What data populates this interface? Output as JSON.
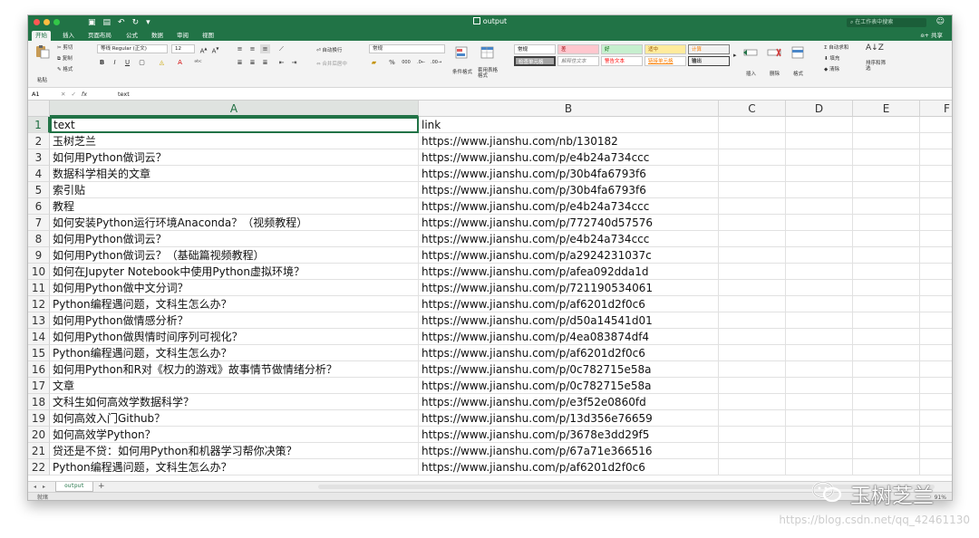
{
  "window": {
    "title": "output",
    "search_placeholder": "在工作表中搜索",
    "colors": {
      "accent": "#217346",
      "close": "#fc5753",
      "minimize": "#fdbc40",
      "zoom": "#33c748"
    }
  },
  "ribbon_tabs": [
    "开始",
    "插入",
    "页面布局",
    "公式",
    "数据",
    "审阅",
    "视图"
  ],
  "share_label": "共享",
  "ribbon": {
    "paste": "粘贴",
    "cut": "剪切",
    "copy": "复制",
    "format_painter": "格式",
    "font_name": "等线 Regular (正文)",
    "font_size": "12",
    "wrap_text": "自动换行",
    "merge_center": "合并后居中",
    "number_format": "常规",
    "percent": "%",
    "thousands": "000",
    "conditional_format": "条件格式",
    "format_as_table": "套用表格格式",
    "styles": [
      {
        "label": "常规",
        "bg": "#ffffff",
        "fg": "#000000"
      },
      {
        "label": "差",
        "bg": "#ffc7ce",
        "fg": "#9c0006"
      },
      {
        "label": "好",
        "bg": "#c6efce",
        "fg": "#006100"
      },
      {
        "label": "适中",
        "bg": "#ffeb9c",
        "fg": "#9c5700"
      },
      {
        "label": "计算",
        "bg": "#f2f2f2",
        "fg": "#fa7d00"
      },
      {
        "label": "检查单元格",
        "bg": "#a5a5a5",
        "fg": "#ffffff"
      },
      {
        "label": "解释性文本",
        "bg": "#ffffff",
        "fg": "#7f7f7f"
      },
      {
        "label": "警告文本",
        "bg": "#ffffff",
        "fg": "#ff0000"
      },
      {
        "label": "链接单元格",
        "bg": "#ffffff",
        "fg": "#fa7d00"
      },
      {
        "label": "输出",
        "bg": "#f2f2f2",
        "fg": "#3f3f3f"
      }
    ],
    "insert": "插入",
    "delete": "删除",
    "format": "格式",
    "autosum": "自动求和",
    "fill": "填充",
    "clear": "清除",
    "sort_filter": "排序和筛选"
  },
  "formula_bar": {
    "cell_ref": "A1",
    "fx": "fx",
    "value": "text"
  },
  "columns": [
    "A",
    "B",
    "C",
    "D",
    "E"
  ],
  "rows": [
    [
      "text",
      "link"
    ],
    [
      "玉树芝兰",
      "https://www.jianshu.com/nb/130182"
    ],
    [
      "如何用Python做词云？",
      "https://www.jianshu.com/p/e4b24a734ccc"
    ],
    [
      "数据科学相关的文章",
      "https://www.jianshu.com/p/30b4fa6793f6"
    ],
    [
      "索引贴",
      "https://www.jianshu.com/p/30b4fa6793f6"
    ],
    [
      "教程",
      "https://www.jianshu.com/p/e4b24a734ccc"
    ],
    [
      "如何安装Python运行环境Anaconda？（视频教程）",
      "https://www.jianshu.com/p/772740d57576"
    ],
    [
      "如何用Python做词云？",
      "https://www.jianshu.com/p/e4b24a734ccc"
    ],
    [
      "如何用Python做词云？（基础篇视频教程）",
      "https://www.jianshu.com/p/a2924231037c"
    ],
    [
      "如何在Jupyter Notebook中使用Python虚拟环境？",
      "https://www.jianshu.com/p/afea092dda1d"
    ],
    [
      "如何用Python做中文分词？",
      "https://www.jianshu.com/p/721190534061"
    ],
    [
      "Python编程遇问题，文科生怎么办？",
      "https://www.jianshu.com/p/af6201d2f0c6"
    ],
    [
      "如何用Python做情感分析？",
      "https://www.jianshu.com/p/d50a14541d01"
    ],
    [
      "如何用Python做舆情时间序列可视化？",
      "https://www.jianshu.com/p/4ea083874df4"
    ],
    [
      "Python编程遇问题，文科生怎么办？",
      "https://www.jianshu.com/p/af6201d2f0c6"
    ],
    [
      "如何用Python和R对《权力的游戏》故事情节做情绪分析？",
      "https://www.jianshu.com/p/0c782715e58a"
    ],
    [
      "文章",
      "https://www.jianshu.com/p/0c782715e58a"
    ],
    [
      "文科生如何高效学数据科学？",
      "https://www.jianshu.com/p/e3f52e0860fd"
    ],
    [
      "如何高效入门Github？",
      "https://www.jianshu.com/p/13d356e76659"
    ],
    [
      "如何高效学Python？",
      "https://www.jianshu.com/p/3678e3dd29f5"
    ],
    [
      "贷还是不贷：如何用Python和机器学习帮你决策？",
      "https://www.jianshu.com/p/67a71e366516"
    ],
    [
      "Python编程遇问题，文科生怎么办？",
      "https://www.jianshu.com/p/af6201d2f0c6"
    ]
  ],
  "row_numbers": [
    "1",
    "2",
    "3",
    "4",
    "5",
    "6",
    "7",
    "8",
    "9",
    "10",
    "11",
    "12",
    "13",
    "14",
    "15",
    "16",
    "17",
    "18",
    "19",
    "20",
    "21",
    "22"
  ],
  "sheet_tab": "output",
  "status": "就绪",
  "zoom": "91%",
  "watermark": {
    "brand": "玉树芝兰",
    "url": "https://blog.csdn.net/qq_42461130"
  }
}
